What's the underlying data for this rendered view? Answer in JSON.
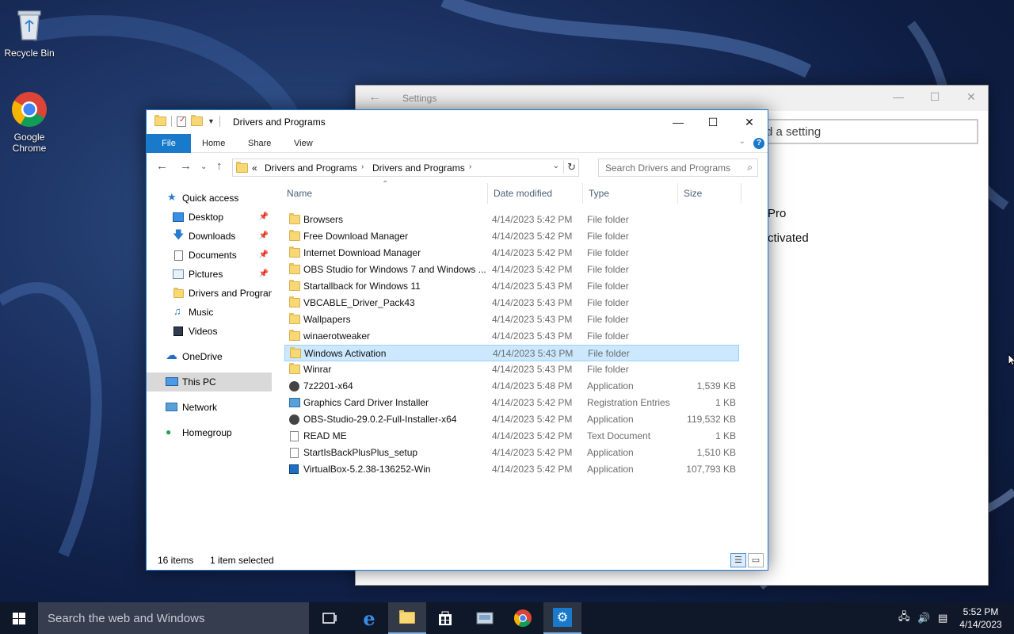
{
  "desktop": {
    "icons": [
      {
        "label": "Recycle Bin"
      },
      {
        "label": "Google Chrome"
      }
    ]
  },
  "settings": {
    "title": "Settings",
    "search_placeholder": "d a setting",
    "text1": "Pro",
    "text2": "ctivated",
    "controls": {
      "minimize": "—",
      "maximize": "☐",
      "close": "✕"
    }
  },
  "explorer": {
    "title": "Drivers and Programs",
    "controls": {
      "minimize": "—",
      "maximize": "☐",
      "close": "✕"
    },
    "ribbon_tabs": [
      "File",
      "Home",
      "Share",
      "View"
    ],
    "breadcrumb": {
      "prefix": "«",
      "items": [
        "Drivers and Programs",
        "Drivers and Programs"
      ]
    },
    "search_placeholder": "Search Drivers and Programs",
    "nav": [
      {
        "label": "Quick access",
        "icon": "star-icon"
      },
      {
        "label": "Desktop",
        "icon": "desktop-icon",
        "pinned": true
      },
      {
        "label": "Downloads",
        "icon": "download-icon",
        "pinned": true
      },
      {
        "label": "Documents",
        "icon": "documents-icon",
        "pinned": true
      },
      {
        "label": "Pictures",
        "icon": "pictures-icon",
        "pinned": true
      },
      {
        "label": "Drivers and Programs",
        "icon": "folder-icon"
      },
      {
        "label": "Music",
        "icon": "music-icon"
      },
      {
        "label": "Videos",
        "icon": "videos-icon"
      },
      {
        "label": "OneDrive",
        "icon": "cloud-icon"
      },
      {
        "label": "This PC",
        "icon": "computer-icon",
        "selected": true
      },
      {
        "label": "Network",
        "icon": "network-icon"
      },
      {
        "label": "Homegroup",
        "icon": "homegroup-icon"
      }
    ],
    "columns": [
      "Name",
      "Date modified",
      "Type",
      "Size"
    ],
    "files": [
      {
        "name": "Browsers",
        "date": "4/14/2023 5:42 PM",
        "type": "File folder",
        "size": "",
        "icon": "folder"
      },
      {
        "name": "Free Download Manager",
        "date": "4/14/2023 5:42 PM",
        "type": "File folder",
        "size": "",
        "icon": "folder"
      },
      {
        "name": "Internet Download Manager",
        "date": "4/14/2023 5:42 PM",
        "type": "File folder",
        "size": "",
        "icon": "folder"
      },
      {
        "name": "OBS Studio for Windows 7 and Windows ...",
        "date": "4/14/2023 5:42 PM",
        "type": "File folder",
        "size": "",
        "icon": "folder"
      },
      {
        "name": "Startallback for Windows 11",
        "date": "4/14/2023 5:43 PM",
        "type": "File folder",
        "size": "",
        "icon": "folder"
      },
      {
        "name": "VBCABLE_Driver_Pack43",
        "date": "4/14/2023 5:43 PM",
        "type": "File folder",
        "size": "",
        "icon": "folder"
      },
      {
        "name": "Wallpapers",
        "date": "4/14/2023 5:43 PM",
        "type": "File folder",
        "size": "",
        "icon": "folder"
      },
      {
        "name": "winaerotweaker",
        "date": "4/14/2023 5:43 PM",
        "type": "File folder",
        "size": "",
        "icon": "folder"
      },
      {
        "name": "Windows Activation",
        "date": "4/14/2023 5:43 PM",
        "type": "File folder",
        "size": "",
        "icon": "folder",
        "selected": true
      },
      {
        "name": "Winrar",
        "date": "4/14/2023 5:43 PM",
        "type": "File folder",
        "size": "",
        "icon": "folder"
      },
      {
        "name": "7z2201-x64",
        "date": "4/14/2023 5:48 PM",
        "type": "Application",
        "size": "1,539 KB",
        "icon": "app"
      },
      {
        "name": "Graphics Card Driver Installer",
        "date": "4/14/2023 5:42 PM",
        "type": "Registration Entries",
        "size": "1 KB",
        "icon": "reg"
      },
      {
        "name": "OBS-Studio-29.0.2-Full-Installer-x64",
        "date": "4/14/2023 5:42 PM",
        "type": "Application",
        "size": "119,532 KB",
        "icon": "app"
      },
      {
        "name": "READ ME",
        "date": "4/14/2023 5:42 PM",
        "type": "Text Document",
        "size": "1 KB",
        "icon": "file"
      },
      {
        "name": "StartIsBackPlusPlus_setup",
        "date": "4/14/2023 5:42 PM",
        "type": "Application",
        "size": "1,510 KB",
        "icon": "file"
      },
      {
        "name": "VirtualBox-5.2.38-136252-Win",
        "date": "4/14/2023 5:42 PM",
        "type": "Application",
        "size": "107,793 KB",
        "icon": "box"
      }
    ],
    "status": {
      "count": "16 items",
      "selection": "1 item selected"
    }
  },
  "taskbar": {
    "search_placeholder": "Search the web and Windows",
    "clock_time": "5:52 PM",
    "clock_date": "4/14/2023",
    "colors": {
      "accent": "#1979ca",
      "selection": "#cce8ff"
    }
  }
}
